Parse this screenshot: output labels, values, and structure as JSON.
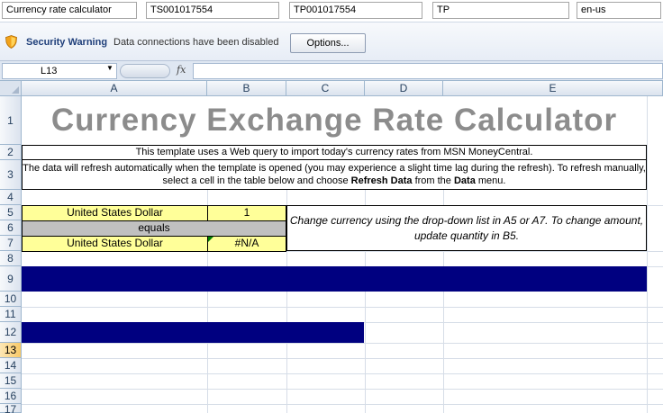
{
  "top_fields": {
    "title": "Currency rate calculator",
    "id1": "TS001017554",
    "id2": "TP001017554",
    "code": "TP",
    "locale": "en-us"
  },
  "security_bar": {
    "title": "Security Warning",
    "message": "Data connections have been disabled",
    "options_label": "Options..."
  },
  "formula_bar": {
    "name_box": "L13",
    "fx_label": "fx",
    "formula": ""
  },
  "columns": [
    "A",
    "B",
    "C",
    "D",
    "E"
  ],
  "rows": [
    "1",
    "2",
    "3",
    "4",
    "5",
    "6",
    "7",
    "8",
    "9",
    "10",
    "11",
    "12",
    "13",
    "14",
    "15",
    "16",
    "17"
  ],
  "selected_row": "13",
  "sheet": {
    "title": "Currency Exchange Rate Calculator",
    "intro": "This template uses a Web query to import today's currency rates from MSN MoneyCentral.",
    "refresh_line1": "The data will refresh automatically when the template is opened (you may experience a slight time lag during the refresh). To refresh manually,",
    "refresh_line2_a": "select a cell in the table below and choose ",
    "refresh_line2_b": "Refresh Data",
    "refresh_line2_c": " from the ",
    "refresh_line2_d": "Data",
    "refresh_line2_e": " menu.",
    "from_currency": "United States Dollar",
    "quantity": "1",
    "equals": "equals",
    "to_currency": "United States Dollar",
    "result": "#N/A",
    "note": "Change currency using the drop-down list in A5 or A7. To change amount, update quantity in B5."
  },
  "colors": {
    "navy_band": "#000080",
    "input_yellow": "#ffff99",
    "equals_gray": "#c0c0c0",
    "title_gray": "#8c8c8c"
  }
}
